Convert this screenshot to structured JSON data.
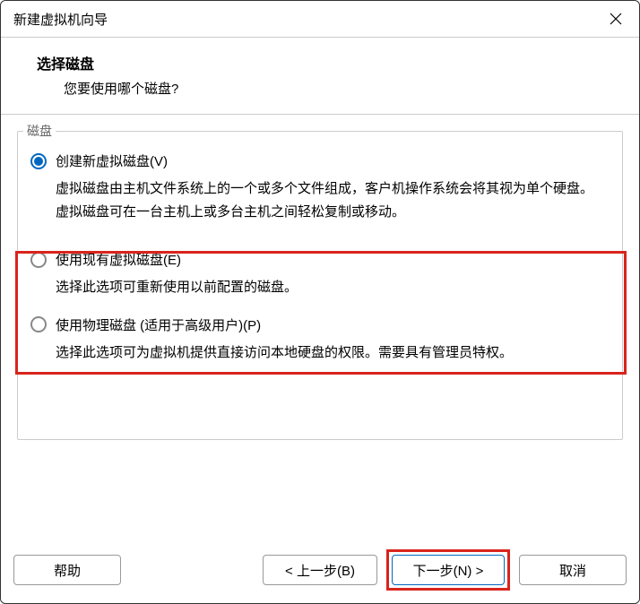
{
  "dialog": {
    "title": "新建虚拟机向导"
  },
  "header": {
    "title": "选择磁盘",
    "subtitle": "您要使用哪个磁盘?"
  },
  "fieldset": {
    "legend": "磁盘"
  },
  "options": {
    "create": {
      "label": "创建新虚拟磁盘(V)",
      "description": "虚拟磁盘由主机文件系统上的一个或多个文件组成，客户机操作系统会将其视为单个硬盘。虚拟磁盘可在一台主机上或多台主机之间轻松复制或移动。"
    },
    "existing": {
      "label": "使用现有虚拟磁盘(E)",
      "description": "选择此选项可重新使用以前配置的磁盘。"
    },
    "physical": {
      "label": "使用物理磁盘 (适用于高级用户)(P)",
      "description": "选择此选项可为虚拟机提供直接访问本地硬盘的权限。需要具有管理员特权。"
    }
  },
  "buttons": {
    "help": "帮助",
    "prev": "< 上一步(B)",
    "next": "下一步(N) >",
    "cancel": "取消"
  }
}
